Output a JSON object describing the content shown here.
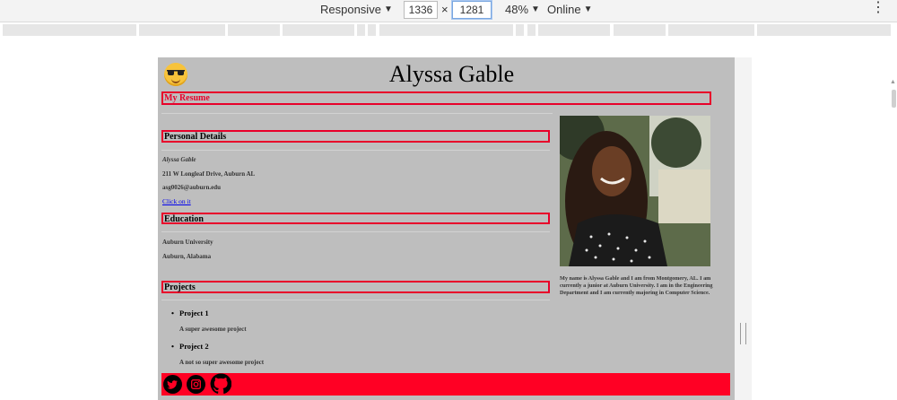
{
  "devtools": {
    "device": "Responsive",
    "width": "1336",
    "times": "×",
    "height": "1281",
    "zoom": "48%",
    "network": "Online",
    "menu_glyph": "⋮",
    "dropdown_glyph": "▼"
  },
  "page": {
    "name": "Alyssa Gable",
    "resume_heading": "My Resume",
    "personal_heading": "Personal Details",
    "personal": {
      "name": "Alyssa Gable",
      "address": "211 W Longleaf Drive, Auburn AL",
      "email": "asg0026@auburn.edu",
      "link": "Click on it"
    },
    "education_heading": "Education",
    "education": {
      "school": "Auburn University",
      "location": "Auburn, Alabama"
    },
    "projects_heading": "Projects",
    "projects": [
      {
        "title": "Project 1",
        "desc": "A super awesome project"
      },
      {
        "title": "Project 2",
        "desc": "A not so super awesome project"
      }
    ],
    "bio": "My name is Alyssa Gable and I am from Montgomery, AL. I am currently a junior at Auburn University. I am in the Engineering Department and I am currently majoring in Computer Science.",
    "footer_icons": [
      "twitter-icon",
      "instagram-icon",
      "github-icon"
    ]
  },
  "colors": {
    "accent": "#ff0024",
    "page_bg": "#bebebe"
  }
}
